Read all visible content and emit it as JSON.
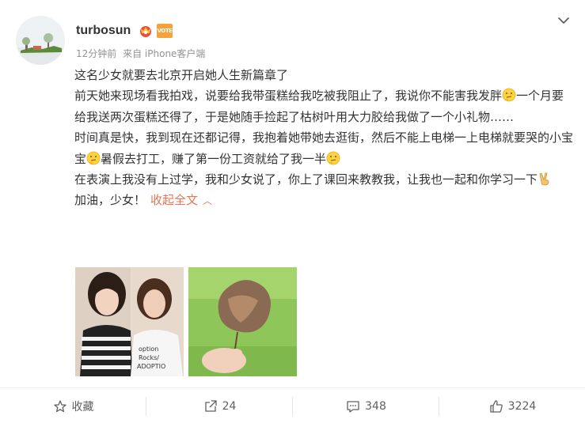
{
  "post": {
    "author": "turbosun",
    "badges": {
      "vip_icon": "crown-badge-icon",
      "vote_label": "VOTE"
    },
    "time": "12分钟前",
    "source": "来自 iPhone客户端",
    "menu_icon": "chevron-down-icon",
    "paragraphs": {
      "p1": "这名少女就要去北京开启她人生新篇章了",
      "p2a": "前天她来现场看我拍戏，说要给我带蛋糕给我吃被我阻止了，我说你不能害我发胖",
      "p2b": "一个月要给我送两次蛋糕还得了，于是她随手捡起了枯树叶用大力胶给我做了一个小礼物……",
      "p3a": "时间真是快，我到现在还都记得，我抱着她带她去逛街，然后不能上电梯一上电梯就要哭的小宝宝",
      "p3b": "暑假去打工，赚了第一份工资就给了我一半",
      "p4": "在表演上我没有上过学，我和少女说了，你上了课回来教教我，让我也一起和你学习一下",
      "p5": "加油，少女！"
    },
    "collapse_label": "收起全文",
    "collapse_caret": "︿",
    "emoji_names": [
      "thinking-emoji-icon",
      "victory-hand-emoji-icon"
    ],
    "photos": [
      {
        "name": "photo-two-women",
        "shirt_text": "doption Rocks ADOPTIO ROCKS"
      },
      {
        "name": "photo-dried-leaf"
      }
    ]
  },
  "actions": {
    "favorite_label": "收藏",
    "repost_count": "24",
    "comment_count": "348",
    "like_count": "3224"
  },
  "colors": {
    "link": "#eb7350",
    "meta": "#939393",
    "text": "#333333",
    "action": "#606060"
  }
}
